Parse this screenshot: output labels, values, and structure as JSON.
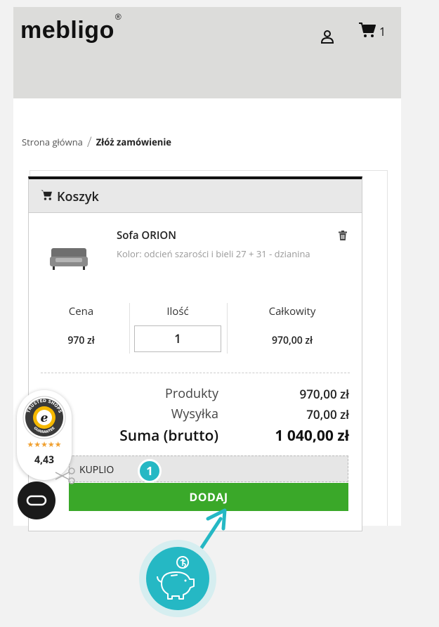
{
  "header": {
    "logo_text": "mebligo",
    "logo_mark": "®",
    "cart_count": "1"
  },
  "breadcrumb": {
    "home": "Strona główna",
    "separator": "/",
    "current": "Złóż zamówienie"
  },
  "cart": {
    "title": "Koszyk",
    "product": {
      "name": "Sofa ORION",
      "variant": "Kolor: odcień szarości i bieli 27 + 31 - dzianina",
      "image": "sofa-image"
    },
    "columns": {
      "price_label": "Cena",
      "qty_label": "Ilość",
      "total_label": "Całkowity"
    },
    "price": "970 zł",
    "quantity": "1",
    "line_total": "970,00 zł",
    "summary": {
      "products_label": "Produkty",
      "products_value": "970,00 zł",
      "shipping_label": "Wysyłka",
      "shipping_value": "70,00 zł",
      "total_label": "Suma (brutto)",
      "total_value": "1 040,00 zł"
    },
    "coupon_label": "KUPLIO",
    "add_button": "DODAJ"
  },
  "annotation_badge": "1",
  "trusted_shops": {
    "seal_text": "TRUSTED SHOPS GUARANTEE",
    "seal_top": "TRUSTED SHOPS",
    "seal_bottom": "GUARANTEE",
    "stars": "★★★★★",
    "rating": "4,43"
  },
  "colors": {
    "accent_green": "#3aa829",
    "accent_teal": "#25b8c4",
    "header_bg": "#dcdcda"
  }
}
